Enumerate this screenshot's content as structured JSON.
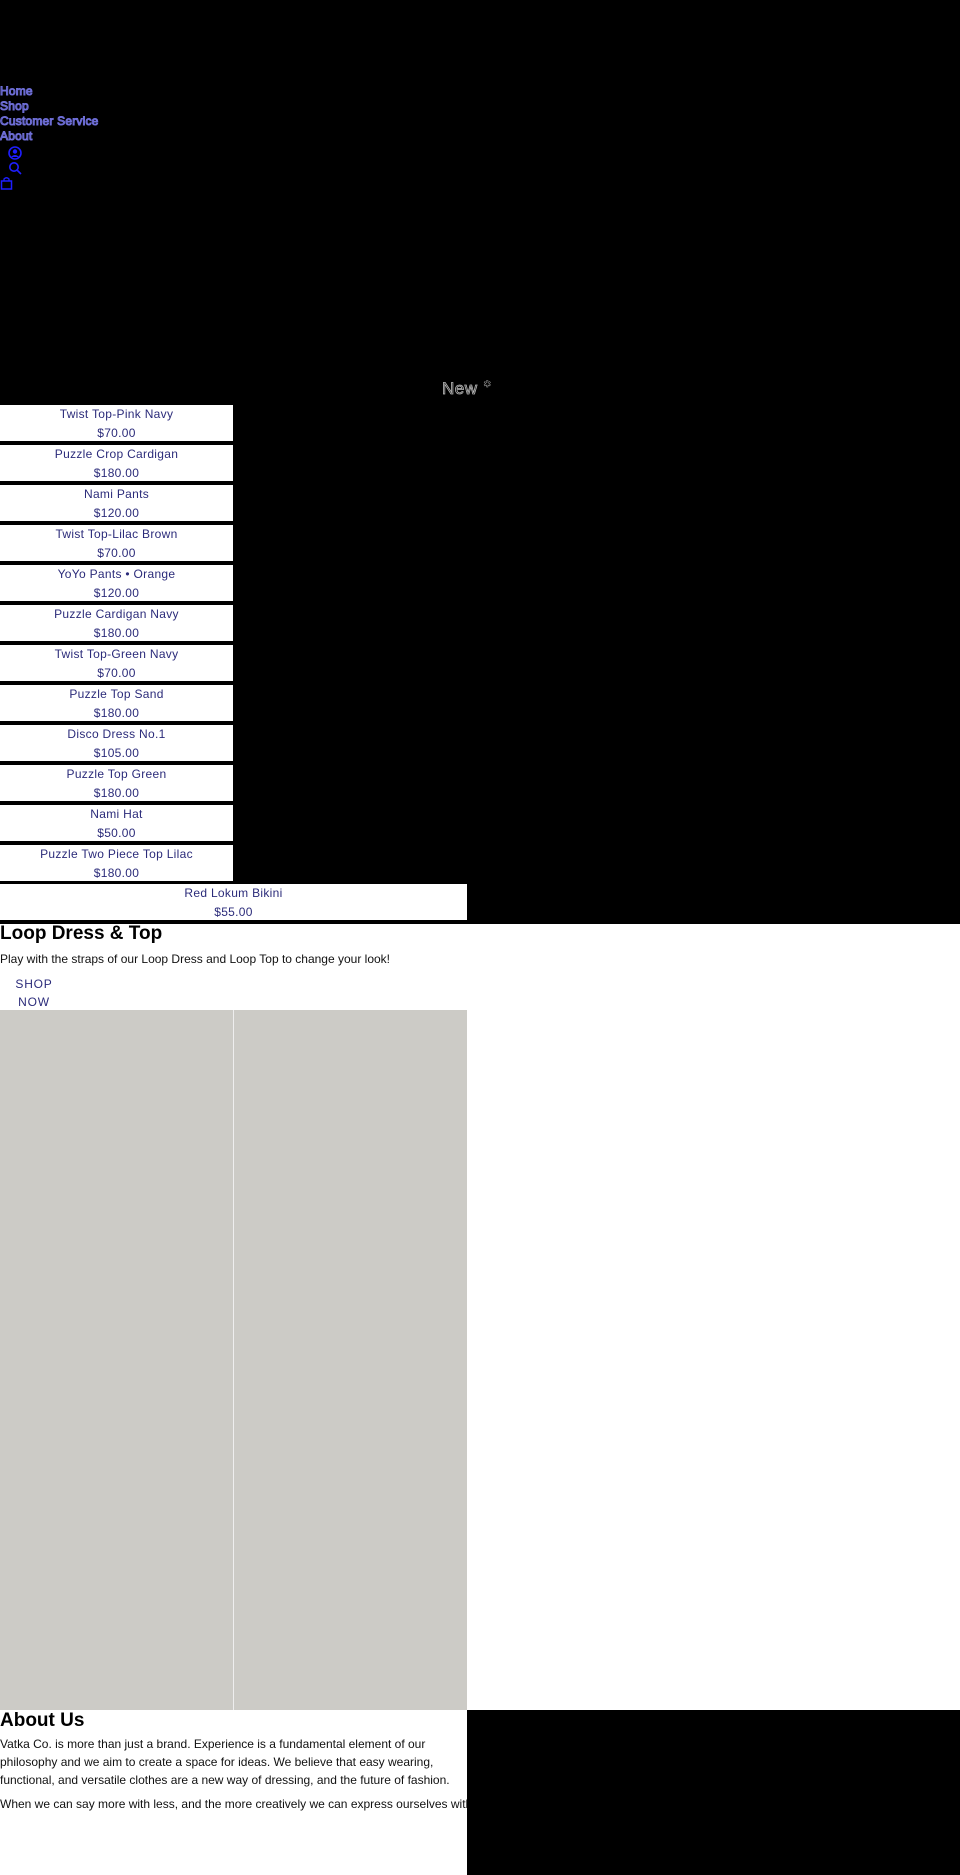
{
  "nav": {
    "items": [
      {
        "label": "Home"
      },
      {
        "label": "Shop"
      },
      {
        "label": "Customer Service"
      },
      {
        "label": "About"
      }
    ],
    "icons": [
      "account-icon",
      "search-icon",
      "cart-icon"
    ]
  },
  "new_section": {
    "heading": "New",
    "heading_icon": "✱"
  },
  "products": [
    {
      "name": "Twist Top-Pink Navy",
      "price": "$70.00"
    },
    {
      "name": "Puzzle Crop Cardigan",
      "price": "$180.00"
    },
    {
      "name": "Nami Pants",
      "price": "$120.00"
    },
    {
      "name": "Twist Top-Lilac Brown",
      "price": "$70.00"
    },
    {
      "name": "YoYo Pants • Orange",
      "price": "$120.00"
    },
    {
      "name": "Puzzle Cardigan Navy",
      "price": "$180.00"
    },
    {
      "name": "Twist Top-Green Navy",
      "price": "$70.00"
    },
    {
      "name": "Puzzle Top Sand",
      "price": "$180.00"
    },
    {
      "name": "Disco Dress No.1",
      "price": "$105.00"
    },
    {
      "name": "Puzzle Top Green",
      "price": "$180.00"
    },
    {
      "name": "Nami Hat",
      "price": "$50.00"
    },
    {
      "name": "Puzzle Two Piece Top Lilac",
      "price": "$180.00"
    },
    {
      "name": "Red Lokum Bikini",
      "price": "$55.00"
    }
  ],
  "loop": {
    "title": "Loop Dress & Top",
    "description": "Play with the straps of our Loop Dress and Loop Top to change your look!",
    "cta_line1": "SHOP",
    "cta_line2": "NOW"
  },
  "about": {
    "title": "About Us",
    "paragraph1": "Vatka Co. is more than just a brand. Experience is a fundamental element of our philosophy and we aim to create a space for ideas. We believe that easy wearing, functional, and versatile clothes are a new way of dressing, and the future of fashion.",
    "paragraph2": "When we can say more with less, and the more creatively we can express ourselves with"
  },
  "colors": {
    "link": "#2b2b7a",
    "nav_outline": "#6f6fd9",
    "icon": "#1e1eff",
    "image_placeholder": "#cccbc6",
    "background": "#000000"
  }
}
